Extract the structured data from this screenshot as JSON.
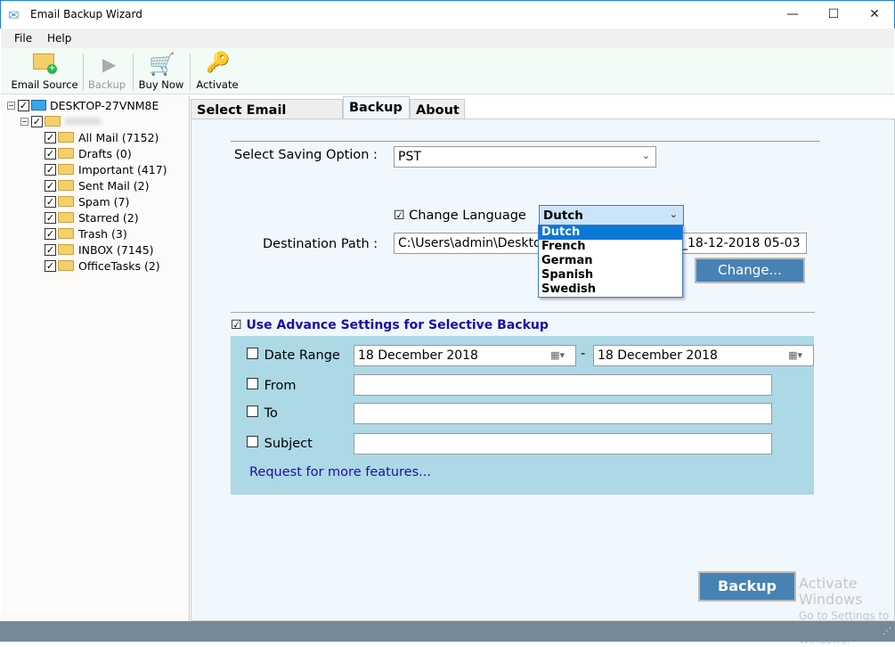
{
  "window": {
    "title": "Email Backup Wizard",
    "controls": [
      "minimize",
      "maximize",
      "close"
    ]
  },
  "menu": [
    "File",
    "Help"
  ],
  "toolbar": {
    "email_source": "Email Source",
    "backup": "Backup",
    "buy_now": "Buy Now",
    "activate": "Activate"
  },
  "tree": {
    "root": "DESKTOP-27VNM8E",
    "account": "",
    "folders": [
      {
        "label": "All Mail (7152)",
        "icon": "folder-icon"
      },
      {
        "label": "Drafts (0)",
        "icon": "drafts-folder-icon"
      },
      {
        "label": "Important (417)",
        "icon": "folder-icon"
      },
      {
        "label": "Sent Mail (2)",
        "icon": "sent-folder-icon"
      },
      {
        "label": "Spam (7)",
        "icon": "folder-icon"
      },
      {
        "label": "Starred (2)",
        "icon": "folder-icon"
      },
      {
        "label": "Trash (3)",
        "icon": "trash-icon"
      },
      {
        "label": "INBOX (7145)",
        "icon": "inbox-folder-icon"
      },
      {
        "label": "OfficeTasks (2)",
        "icon": "tasks-icon"
      }
    ]
  },
  "tabs": [
    "Select Email Source",
    "Backup",
    "About"
  ],
  "backup": {
    "saving_option_label": "Select Saving Option :",
    "saving_option_value": "PST",
    "change_language_label": "Change Language",
    "change_language_checked": true,
    "language_value": "Dutch",
    "language_options": [
      "Dutch",
      "French",
      "German",
      "Spanish",
      "Swedish"
    ],
    "destination_label": "Destination Path :",
    "destination_value_start": "C:\\Users\\admin\\Deskto",
    "destination_value_end": "_18-12-2018 05-03",
    "change_button": "Change...",
    "advance_label": "Use Advance Settings for Selective Backup",
    "advance_checked": true,
    "date_range_label": "Date Range",
    "date_from": "18  December  2018",
    "date_to": "18  December  2018",
    "date_sep": "-",
    "from_label": "From",
    "to_label": "To",
    "subject_label": "Subject",
    "request_link": "Request for more features...",
    "backup_button": "Backup"
  },
  "watermark": {
    "line1": "Activate Windows",
    "line2": "Go to Settings to activate Windows."
  },
  "colors": {
    "accent": "#4682b4",
    "advance_bg": "#add8e6",
    "selected_option": "#0a78d7",
    "status_bar": "#778899"
  }
}
